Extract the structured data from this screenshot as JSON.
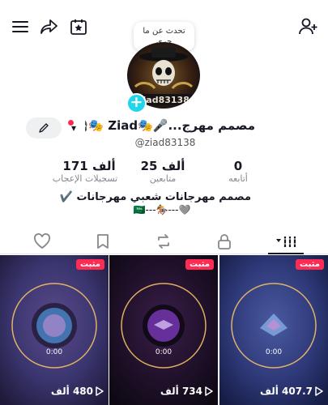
{
  "bubble": {
    "line1": "تحدث عن ما",
    "line2": "جرى"
  },
  "profile": {
    "display_name": "مصمم مهرج...🎤🎭Ziad 🎭🎧",
    "username": "@ziad83138",
    "avatar_text": "ziad83138"
  },
  "stats": [
    {
      "value": "0",
      "label": "أتابعه"
    },
    {
      "value": "25 ألف",
      "label": "متابعين"
    },
    {
      "value": "171 ألف",
      "label": "تسجيلات الإعجاب"
    }
  ],
  "bio": {
    "line1": "مصمم مهرجانات شعبي مهرجانات ✔️",
    "line2": "🇸🇦---🏇---🩶"
  },
  "videos": [
    {
      "pinned": "مثبت",
      "timer": "0:00",
      "views": "480 ألف"
    },
    {
      "pinned": "مثبت",
      "timer": "0:00",
      "views": "734 ألف"
    },
    {
      "pinned": "مثبت",
      "timer": "0:00",
      "views": "407.7 ألف"
    }
  ],
  "colors": {
    "accent": "#fe2c55",
    "plus": "#20d5ec"
  }
}
